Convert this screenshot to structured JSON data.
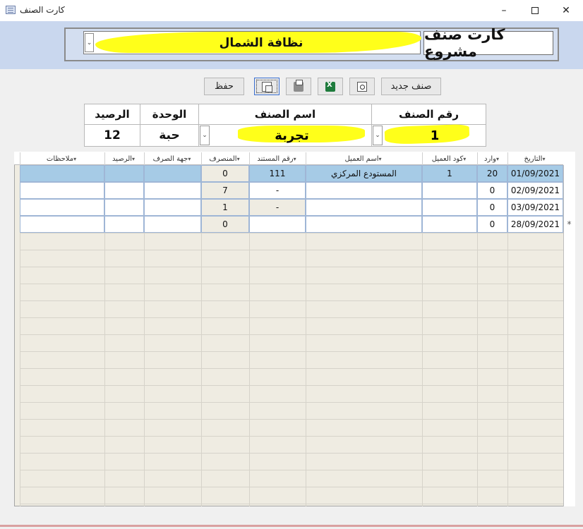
{
  "window": {
    "title": "كارت الصنف",
    "minimize": "–",
    "close": "✕"
  },
  "header": {
    "form_title": "كارت صنف مشروع",
    "project_name": "نظافة الشمال",
    "dropdown_glyph": "⌄",
    "highlight_color": "#ffff1a"
  },
  "toolbar": {
    "new_item": "صنف جديد",
    "save": "حفظ",
    "icons": [
      "preview-icon",
      "excel-export-icon",
      "print-icon",
      "copy-icon"
    ]
  },
  "item_info": {
    "code_label": "رقم الصنف",
    "name_label": "اسم الصنف",
    "unit_label": "الوحدة",
    "balance_label": "الرصيد",
    "code_value": "1",
    "name_value": "تجربة",
    "unit_value": "حبة",
    "balance_value": "12"
  },
  "table": {
    "columns": [
      {
        "key": "date",
        "label": "التاريخ"
      },
      {
        "key": "incoming",
        "label": "وارد"
      },
      {
        "key": "client_code",
        "label": "كود العميل"
      },
      {
        "key": "client_name",
        "label": "اسم العميل"
      },
      {
        "key": "doc_no",
        "label": "رقم المستند"
      },
      {
        "key": "outgoing",
        "label": "المنصرف"
      },
      {
        "key": "issue_to",
        "label": "جهة الصرف"
      },
      {
        "key": "balance",
        "label": "الرصيد"
      },
      {
        "key": "notes",
        "label": "ملاحظات"
      }
    ],
    "rows": [
      {
        "date": "01/09/2021",
        "incoming": "20",
        "client_code": "1",
        "client_name": "المستودع المركزي",
        "doc_no": "111",
        "outgoing": "0",
        "issue_to": "",
        "balance": "",
        "notes": ""
      },
      {
        "date": "02/09/2021",
        "incoming": "0",
        "client_code": "",
        "client_name": "",
        "doc_no": "-",
        "outgoing": "7",
        "issue_to": "",
        "balance": "",
        "notes": ""
      },
      {
        "date": "03/09/2021",
        "incoming": "0",
        "client_code": "",
        "client_name": "",
        "doc_no": "-",
        "outgoing": "1",
        "issue_to": "",
        "balance": "",
        "notes": ""
      },
      {
        "date": "28/09/2021",
        "incoming": "0",
        "client_code": "",
        "client_name": "",
        "doc_no": "",
        "outgoing": "0",
        "issue_to": "",
        "balance": "",
        "notes": ""
      }
    ],
    "new_row_marker": "*",
    "selected_row_color": "#a6cbe6",
    "header_sort_glyph": "▾"
  }
}
